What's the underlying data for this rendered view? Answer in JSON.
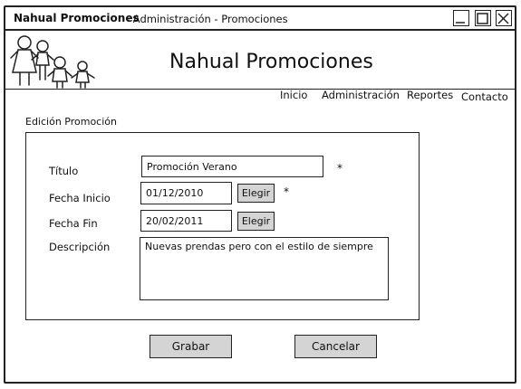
{
  "window": {
    "app_title": "Nahual Promociones",
    "subtitle": "- Administración - Promociones",
    "controls": {
      "minimize": "minimize-icon",
      "maximize": "maximize-icon",
      "close": "close-icon"
    }
  },
  "header": {
    "title": "Nahual Promociones",
    "logo_icon": "family-figures-icon"
  },
  "nav": {
    "items": [
      {
        "label": "Inicio"
      },
      {
        "label": "Administración"
      },
      {
        "label": "Reportes"
      },
      {
        "label": "Contacto"
      }
    ]
  },
  "form": {
    "section_title": "Edición Promoción",
    "titulo": {
      "label": "Título",
      "value": "Promoción Verano",
      "required_mark": "*"
    },
    "fecha_inicio": {
      "label": "Fecha Inicio",
      "value": "01/12/2010",
      "button": "Elegir",
      "required_mark": "*"
    },
    "fecha_fin": {
      "label": "Fecha Fin",
      "value": "20/02/2011",
      "button": "Elegir"
    },
    "descripcion": {
      "label": "Descripción",
      "value": "Nuevas prendas pero con el estilo de siempre"
    }
  },
  "actions": {
    "save": "Grabar",
    "cancel": "Cancelar"
  }
}
